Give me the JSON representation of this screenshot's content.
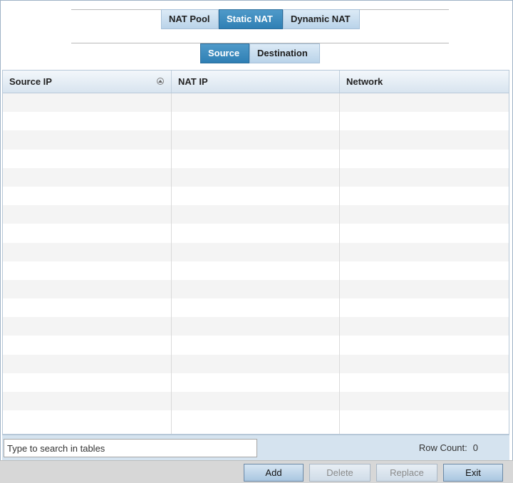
{
  "top_tabs": [
    {
      "label": "NAT Pool",
      "active": false
    },
    {
      "label": "Static NAT",
      "active": true
    },
    {
      "label": "Dynamic NAT",
      "active": false
    }
  ],
  "sub_tabs": [
    {
      "label": "Source",
      "active": true
    },
    {
      "label": "Destination",
      "active": false
    }
  ],
  "table": {
    "columns": [
      "Source IP",
      "NAT IP",
      "Network"
    ],
    "sorted_column": "Source IP",
    "rows": []
  },
  "footer": {
    "search_placeholder": "Type to search in tables",
    "row_count_label": "Row Count:",
    "row_count_value": "0"
  },
  "actions": {
    "add": "Add",
    "delete": "Delete",
    "replace": "Replace",
    "exit": "Exit"
  },
  "colors": {
    "active_tab": "#2f7fb4",
    "inactive_tab": "#c9deef",
    "footer_bg": "#d5e3ef"
  }
}
